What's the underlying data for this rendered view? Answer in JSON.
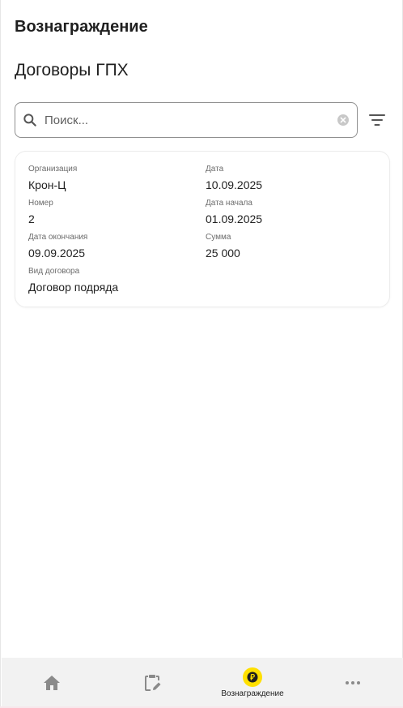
{
  "header": {
    "title": "Вознаграждение"
  },
  "section": {
    "title": "Договоры ГПХ"
  },
  "search": {
    "placeholder": "Поиск..."
  },
  "contract": {
    "organization": {
      "label": "Организация",
      "value": "Крон-Ц"
    },
    "date": {
      "label": "Дата",
      "value": "10.09.2025"
    },
    "number": {
      "label": "Номер",
      "value": "2"
    },
    "start_date": {
      "label": "Дата начала",
      "value": "01.09.2025"
    },
    "end_date": {
      "label": "Дата окончания",
      "value": "09.09.2025"
    },
    "amount": {
      "label": "Сумма",
      "value": "25 000"
    },
    "type": {
      "label": "Вид договора",
      "value": "Договор подряда"
    }
  },
  "bottom_nav": {
    "items": [
      {
        "icon": "home-icon"
      },
      {
        "icon": "clipboard-edit-icon"
      },
      {
        "icon": "ruble-coin-icon",
        "label": "Вознаграждение",
        "active": true
      },
      {
        "icon": "more-icon"
      }
    ]
  },
  "colors": {
    "accent": "#ffe000",
    "nav_background": "#f2f2f2"
  }
}
